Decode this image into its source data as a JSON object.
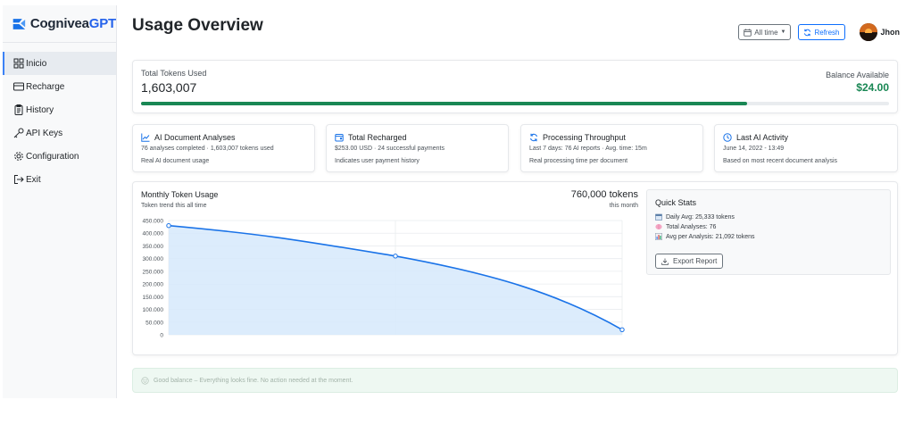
{
  "brand": {
    "name_main": "Cogniveа",
    "name_accent": "GPT",
    "accent_color": "#2563eb"
  },
  "sidebar": {
    "items": [
      {
        "label": "Inicio",
        "icon": "grid-icon",
        "active": true
      },
      {
        "label": "Recharge",
        "icon": "card-icon"
      },
      {
        "label": "History",
        "icon": "clipboard-icon"
      },
      {
        "label": "API Keys",
        "icon": "key-icon"
      },
      {
        "label": "Configuration",
        "icon": "gear-icon"
      },
      {
        "label": "Exit",
        "icon": "exit-icon"
      }
    ]
  },
  "header": {
    "title": "Usage Overview",
    "time_filter": "All time",
    "refresh_label": "Refresh",
    "user_name": "Jhon"
  },
  "tokens": {
    "label": "Total Tokens Used",
    "value": "1,603,007",
    "balance_label": "Balance Available",
    "balance_value": "$24.00",
    "progress_fraction": 0.81,
    "progress_color": "#198754"
  },
  "stats": [
    {
      "title": "AI Document Analyses",
      "icon": "line-chart-icon",
      "sub": "76 analyses completed · 1,603,007 tokens used",
      "desc": "Real AI document usage"
    },
    {
      "title": "Total Recharged",
      "icon": "wallet-icon",
      "sub": "$253.00 USD · 24 successful payments",
      "desc": "Indicates user payment history"
    },
    {
      "title": "Processing Throughput",
      "icon": "sync-icon",
      "sub": "Last 7 days: 76 AI reports · Avg. time: 15m",
      "desc": "Real processing time per document"
    },
    {
      "title": "Last AI Activity",
      "icon": "clock-icon",
      "sub": "June 14, 2022 - 13:49",
      "desc": "Based on most recent document analysis"
    }
  ],
  "chart_panel": {
    "title": "Monthly Token Usage",
    "subtitle": "Token trend this all time",
    "total_value": "760,000 tokens",
    "total_sub": "this month"
  },
  "chart_data": {
    "type": "area",
    "x": [
      0,
      1,
      2
    ],
    "series": [
      {
        "values": [
          430000,
          310000,
          20000
        ]
      }
    ],
    "ylim": [
      0,
      450000
    ],
    "yticks": [
      "0",
      "50.000",
      "100.000",
      "150.000",
      "200.000",
      "250.000",
      "300.000",
      "350.000",
      "400.000",
      "450.000"
    ],
    "grid": true,
    "line_color": "#1a73e8",
    "fill_color": "#d6e9fb"
  },
  "quick_stats": {
    "title": "Quick Stats",
    "items": [
      {
        "icon": "calendar-icon",
        "text": "Daily Avg: 25,333 tokens"
      },
      {
        "icon": "brain-icon",
        "text": "Total Analyses: 76"
      },
      {
        "icon": "bar-chart-icon",
        "text": "Avg per Analysis: 21,092 tokens"
      }
    ],
    "export_label": "Export Report"
  },
  "alert": {
    "text": "Good balance – Everything looks fine. No action needed at the moment."
  }
}
